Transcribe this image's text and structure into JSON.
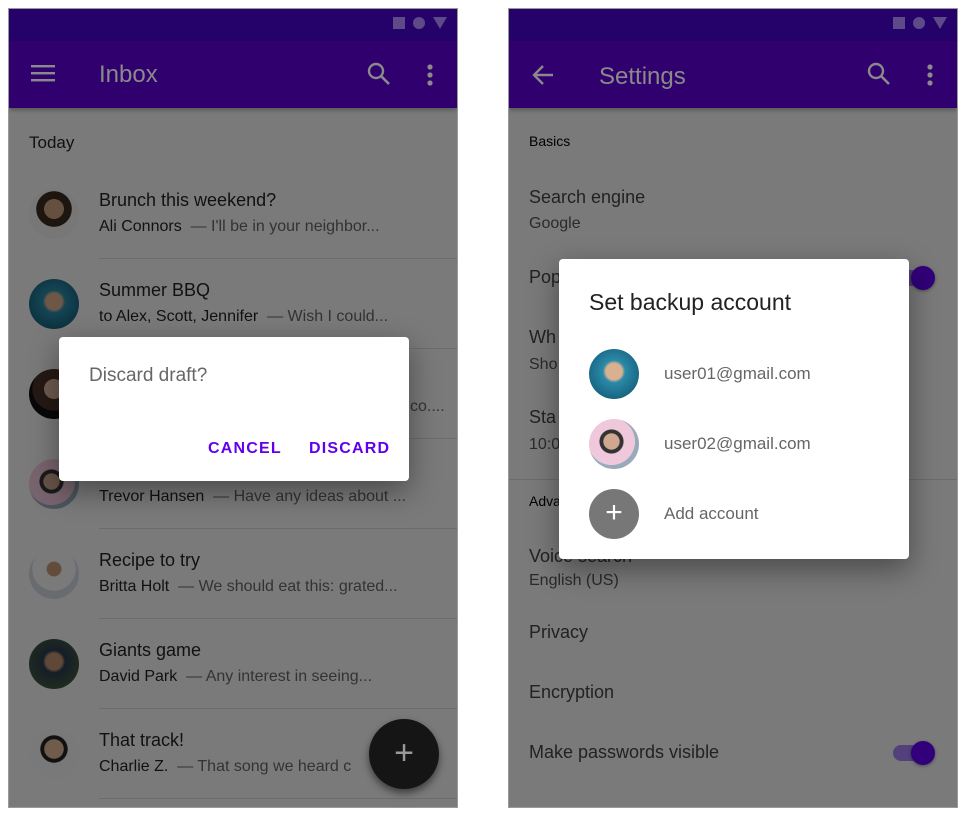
{
  "inbox": {
    "title": "Inbox",
    "section": "Today",
    "messages": [
      {
        "title": "Brunch this weekend?",
        "sender": "Ali Connors",
        "snippet": "— I'll be in your neighbor..."
      },
      {
        "title": "Summer BBQ",
        "sender": "to Alex, Scott, Jennifer",
        "snippet": "— Wish I could..."
      },
      {
        "title": "",
        "sender": "",
        "snippet": "co...."
      },
      {
        "title": "",
        "sender": "Trevor Hansen",
        "snippet": "— Have any ideas about ..."
      },
      {
        "title": "Recipe to try",
        "sender": "Britta Holt",
        "snippet": "— We should eat this: grated..."
      },
      {
        "title": "Giants game",
        "sender": "David Park",
        "snippet": "— Any interest in seeing..."
      },
      {
        "title": "That track!",
        "sender": "Charlie Z.",
        "snippet": "— That song we heard c"
      }
    ],
    "fab_label": "+",
    "dialog": {
      "message": "Discard draft?",
      "cancel": "CANCEL",
      "confirm": "DISCARD"
    }
  },
  "settings": {
    "title": "Settings",
    "basics": "Basics",
    "search_engine": {
      "label": "Search engine",
      "value": "Google"
    },
    "partial": {
      "pop": "Pop",
      "wh": "Wh",
      "sho": "Sho",
      "sta": "Sta",
      "time": "10:0",
      "adva": "Adva",
      "voice": "Voice search"
    },
    "voice_value": "English (US)",
    "privacy": "Privacy",
    "encryption": "Encryption",
    "passwords_visible": "Make passwords visible",
    "toggles": {
      "pop": true,
      "passwords_visible": true
    },
    "dialog": {
      "title": "Set backup account",
      "accounts": [
        "user01@gmail.com",
        "user02@gmail.com"
      ],
      "add": "Add account"
    }
  },
  "colors": {
    "primary": "#6200ee",
    "status": "#4a00b0"
  }
}
